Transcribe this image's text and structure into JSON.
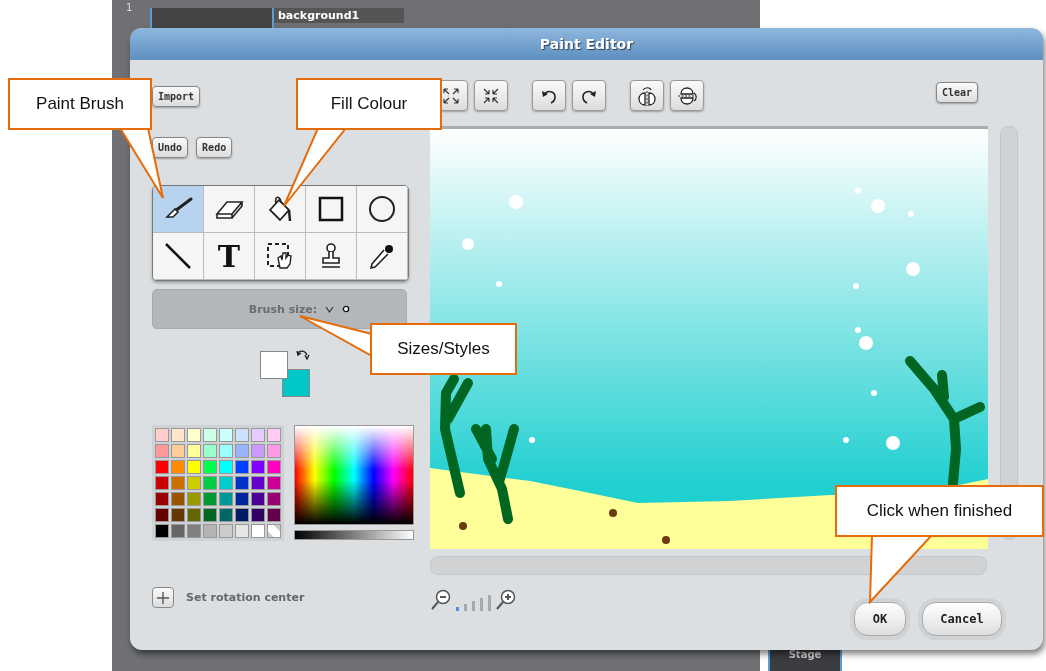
{
  "backdrop": {
    "costume_number": "1",
    "costume_name": "background1",
    "stage_label": "Stage"
  },
  "window": {
    "title": "Paint Editor"
  },
  "import_button": "Import",
  "undo_button": "Undo",
  "redo_button": "Redo",
  "tools": [
    {
      "kind": "brush",
      "selected": true
    },
    {
      "kind": "eraser",
      "selected": false
    },
    {
      "kind": "fill",
      "selected": false
    },
    {
      "kind": "rectangle",
      "selected": false
    },
    {
      "kind": "ellipse",
      "selected": false
    },
    {
      "kind": "line",
      "selected": false
    },
    {
      "kind": "text",
      "glyph": "T",
      "selected": false
    },
    {
      "kind": "select",
      "selected": false
    },
    {
      "kind": "stamp",
      "selected": false
    },
    {
      "kind": "eyedropper",
      "selected": false
    }
  ],
  "brush_size": {
    "label": "Brush size:"
  },
  "selected_colors": [
    {
      "color": "#ffffff"
    },
    {
      "color": "#00c8c8"
    }
  ],
  "swatches": [
    {
      "color": "#ffcccc"
    },
    {
      "color": "#ffe5cc"
    },
    {
      "color": "#ffffcc"
    },
    {
      "color": "#ccffe5"
    },
    {
      "color": "#ccffff"
    },
    {
      "color": "#cce0ff"
    },
    {
      "color": "#e5ccff"
    },
    {
      "color": "#ffccf2"
    },
    {
      "color": "#ff9999"
    },
    {
      "color": "#ffcc99"
    },
    {
      "color": "#ffff99"
    },
    {
      "color": "#99ffcc"
    },
    {
      "color": "#99ffff"
    },
    {
      "color": "#99b3ff"
    },
    {
      "color": "#cc99ff"
    },
    {
      "color": "#ff99e5"
    },
    {
      "color": "#ff0000"
    },
    {
      "color": "#ff8c00"
    },
    {
      "color": "#ffff00"
    },
    {
      "color": "#00ff4c"
    },
    {
      "color": "#00ffff"
    },
    {
      "color": "#0040ff"
    },
    {
      "color": "#8000ff"
    },
    {
      "color": "#ff00bf"
    },
    {
      "color": "#cc0000"
    },
    {
      "color": "#cc7000"
    },
    {
      "color": "#cccc00"
    },
    {
      "color": "#00cc44"
    },
    {
      "color": "#00cccc"
    },
    {
      "color": "#0033cc"
    },
    {
      "color": "#6600cc"
    },
    {
      "color": "#cc0099"
    },
    {
      "color": "#990000"
    },
    {
      "color": "#995400"
    },
    {
      "color": "#999900"
    },
    {
      "color": "#009933"
    },
    {
      "color": "#009999"
    },
    {
      "color": "#002699"
    },
    {
      "color": "#4d0099"
    },
    {
      "color": "#990073"
    },
    {
      "color": "#660000"
    },
    {
      "color": "#663800"
    },
    {
      "color": "#666600"
    },
    {
      "color": "#006622"
    },
    {
      "color": "#006666"
    },
    {
      "color": "#001a66"
    },
    {
      "color": "#330066"
    },
    {
      "color": "#66004d"
    },
    {
      "color": "#000000"
    },
    {
      "color": "#666666"
    },
    {
      "color": "#808080"
    },
    {
      "color": "#b3b3b3"
    },
    {
      "color": "#cccccc"
    },
    {
      "color": "#e6e6e6"
    },
    {
      "color": "#ffffff"
    },
    {
      "color": "#ffffff",
      "transparent": true
    }
  ],
  "rotation_center": {
    "label": "Set rotation center"
  },
  "canvas_tools": [
    {
      "kind": "enlarge"
    },
    {
      "kind": "shrink"
    },
    {
      "kind": "rotate-left"
    },
    {
      "kind": "rotate-right"
    },
    {
      "kind": "flip-horizontal"
    },
    {
      "kind": "flip-vertical"
    }
  ],
  "clear_button": "Clear",
  "zoom_steps": [
    {
      "selected": true
    },
    {
      "selected": false
    },
    {
      "selected": false
    },
    {
      "selected": false
    },
    {
      "selected": false
    }
  ],
  "buttons": [
    {
      "label": "OK"
    },
    {
      "label": "Cancel"
    }
  ],
  "callouts": [
    {
      "text": "Paint Brush"
    },
    {
      "text": "Fill Colour"
    },
    {
      "text": "Sizes/Styles"
    },
    {
      "text": "Click when finished"
    }
  ]
}
